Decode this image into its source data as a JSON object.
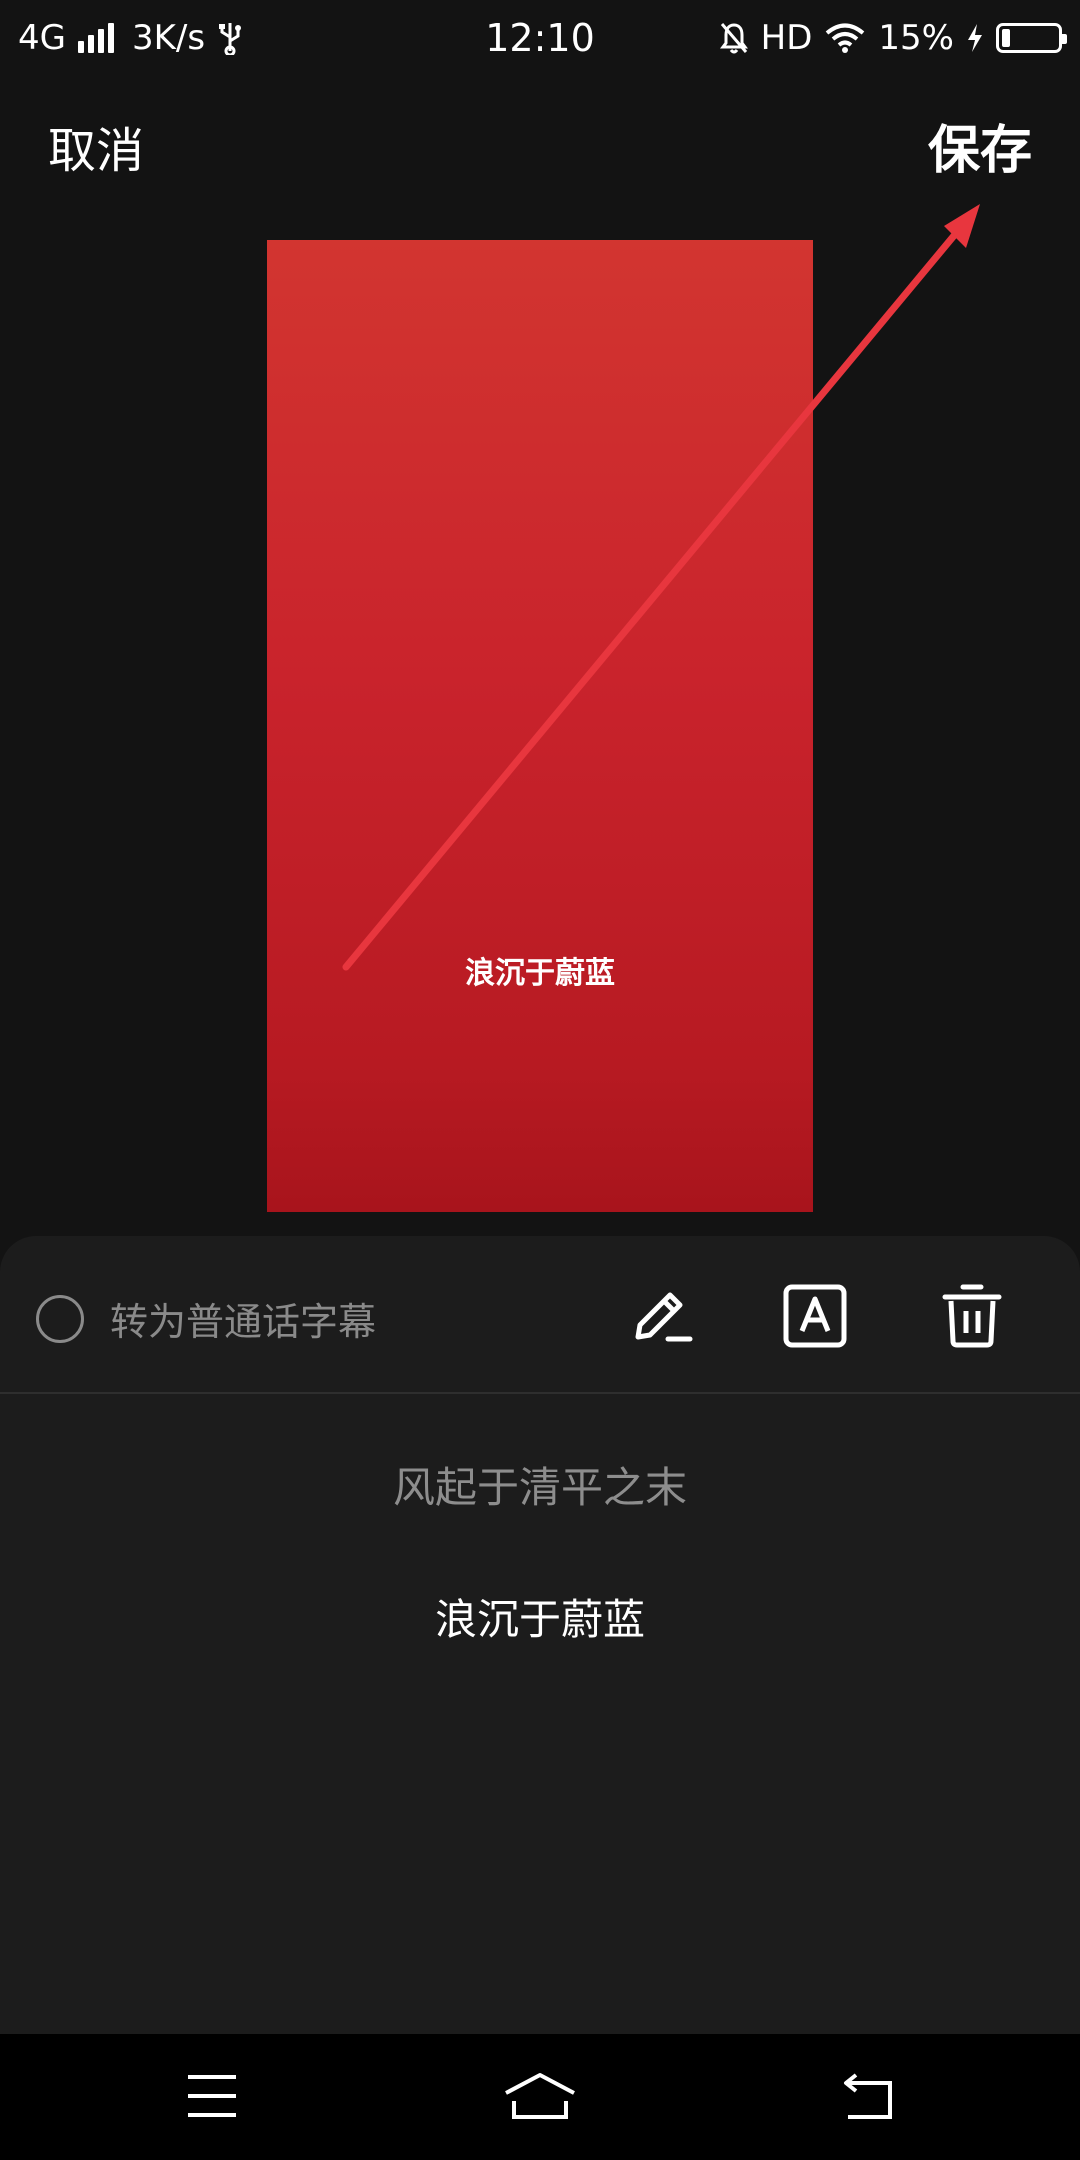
{
  "status_bar": {
    "network": "4G",
    "speed": "3K/s",
    "time": "12:10",
    "hd": "HD",
    "battery_percent": "15%",
    "battery_level": 0.15
  },
  "header": {
    "cancel_label": "取消",
    "save_label": "保存"
  },
  "preview": {
    "subtitle_text": "浪沉于蔚蓝",
    "background_color": "#c9232c",
    "annotation_arrow_color": "#e8363e"
  },
  "toolbar": {
    "mandarin_label": "转为普通话字幕",
    "icons": [
      "edit-icon",
      "font-style-icon",
      "trash-icon"
    ]
  },
  "subtitles": [
    {
      "text": "风起于清平之末",
      "state": "inactive"
    },
    {
      "text": "浪沉于蔚蓝",
      "state": "active"
    }
  ],
  "nav_bar": {
    "icons": [
      "menu-icon",
      "home-icon",
      "back-icon"
    ]
  }
}
